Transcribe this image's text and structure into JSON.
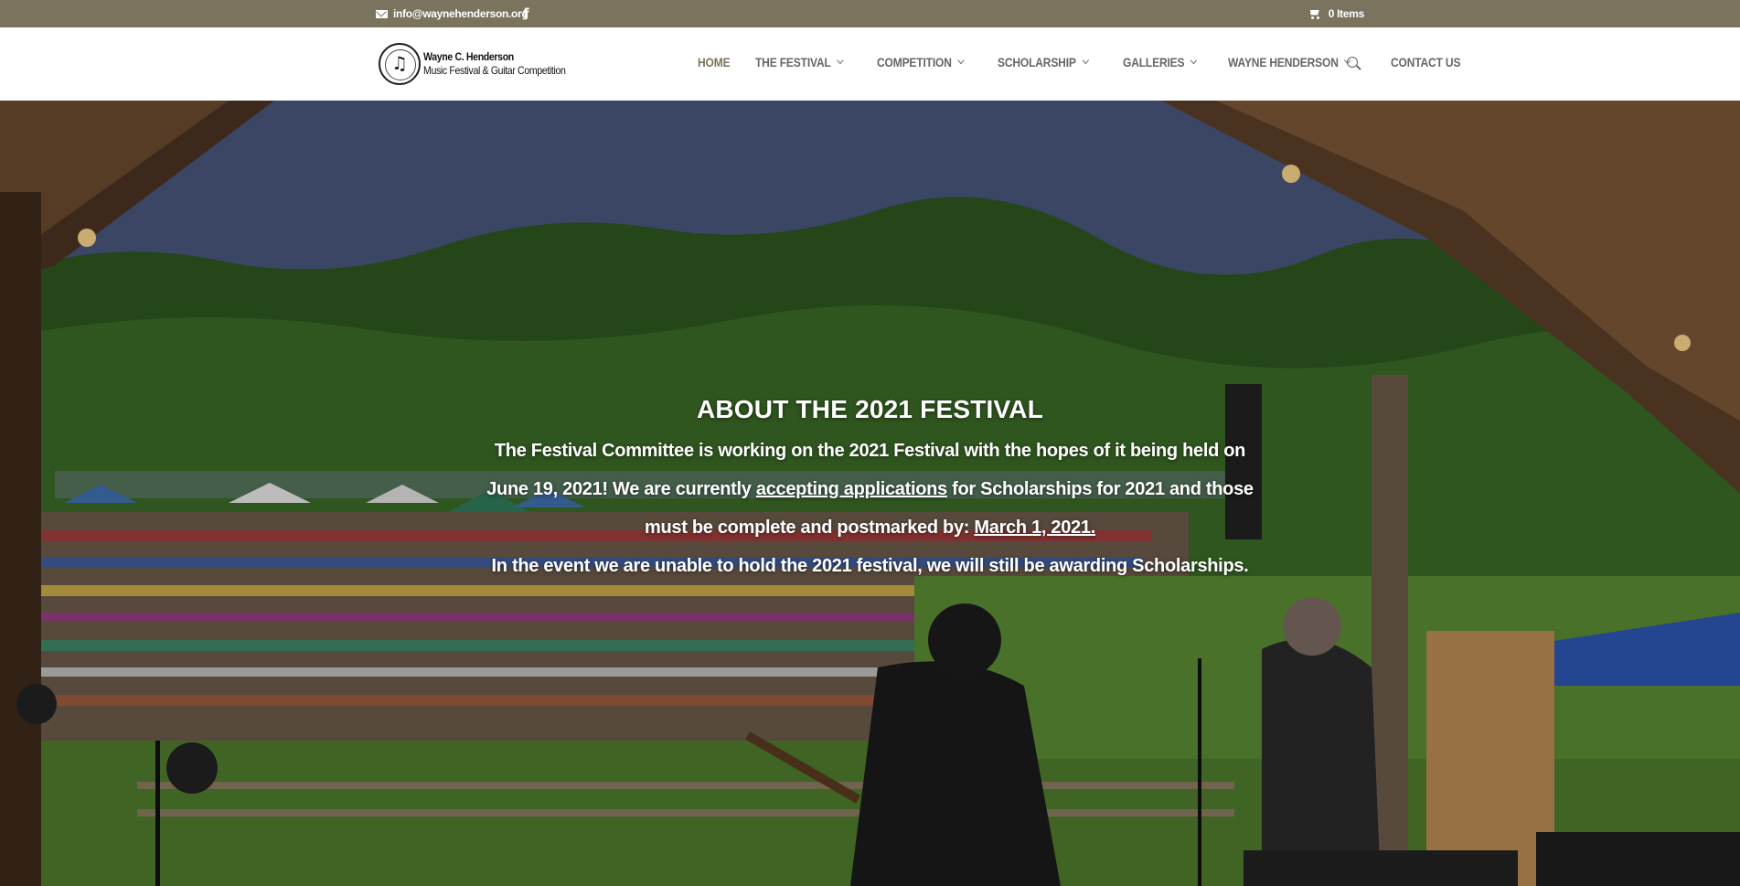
{
  "topbar": {
    "email": "info@waynehenderson.org",
    "facebook_icon": "facebook-icon",
    "cart_label": "0 Items"
  },
  "header": {
    "logo_line1": "Wayne C. Henderson",
    "logo_line2": "Music Festival & Guitar Competition",
    "nav": [
      {
        "label": "HOME",
        "active": true,
        "dropdown": false
      },
      {
        "label": "THE FESTIVAL",
        "dropdown": true
      },
      {
        "label": "COMPETITION",
        "dropdown": true
      },
      {
        "label": "SCHOLARSHIP",
        "dropdown": true
      },
      {
        "label": "GALLERIES",
        "dropdown": true
      },
      {
        "label": "WAYNE HENDERSON",
        "dropdown": true
      },
      {
        "label": "CONTACT US",
        "dropdown": false
      }
    ]
  },
  "hero": {
    "title": "ABOUT THE 2021 FESTIVAL",
    "p1_a": "The Festival Committee is working on the 2021 Festival with the hopes of it being held on June 19, 2021! We are currently ",
    "p1_link1": "accepting applications",
    "p1_b": " for Scholarships for 2021 and those must be complete and postmarked by: ",
    "p1_link2": "March 1, 2021.",
    "p2": "In the event we are unable to hold the 2021 festival, we will still be awarding Scholarships."
  }
}
